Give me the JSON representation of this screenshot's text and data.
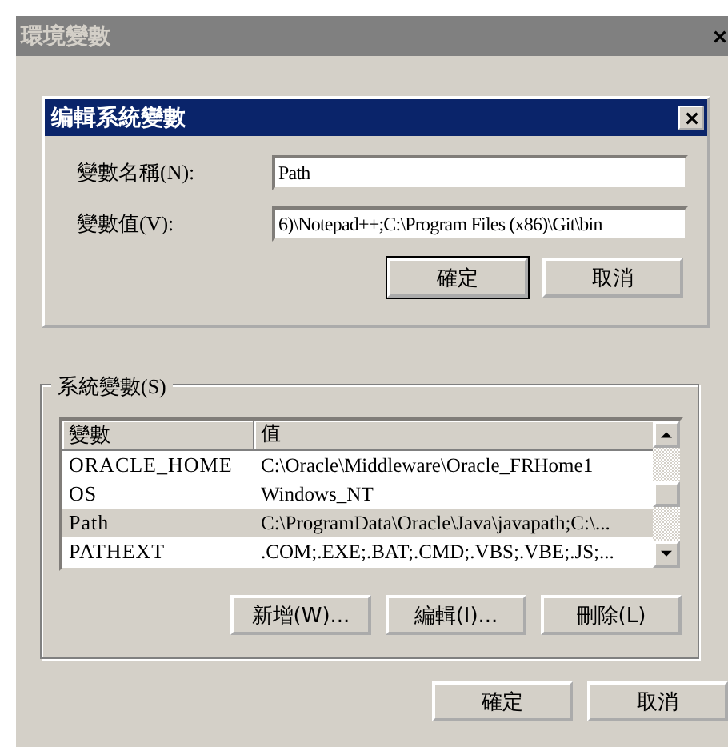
{
  "window": {
    "title": "環境變數"
  },
  "dialog": {
    "title": "编輯系統變數",
    "fields": [
      {
        "label": "變數名稱(N):",
        "value": "Path"
      },
      {
        "label": "變數值(V):",
        "value": "6)\\Notepad++;C:\\Program Files (x86)\\Git\\bin"
      }
    ],
    "buttons": [
      {
        "label": "確定",
        "default": true
      },
      {
        "label": "取消",
        "default": false
      }
    ]
  },
  "system_variables": {
    "legend": "系統變數(S)",
    "columns": [
      "變數",
      "值"
    ],
    "rows": [
      {
        "name": "ORACLE_HOME",
        "value": "C:\\Oracle\\Middleware\\Oracle_FRHome1",
        "selected": false
      },
      {
        "name": "OS",
        "value": "Windows_NT",
        "selected": false
      },
      {
        "name": "Path",
        "value": "C:\\ProgramData\\Oracle\\Java\\javapath;C:\\...",
        "selected": true
      },
      {
        "name": "PATHEXT",
        "value": ".COM;.EXE;.BAT;.CMD;.VBS;.VBE;.JS;...",
        "selected": false
      }
    ],
    "buttons": [
      "新增(W)...",
      "編輯(I)...",
      "刪除(L)"
    ]
  },
  "buttons": [
    {
      "label": "確定",
      "default": false
    },
    {
      "label": "取消",
      "default": false
    }
  ]
}
